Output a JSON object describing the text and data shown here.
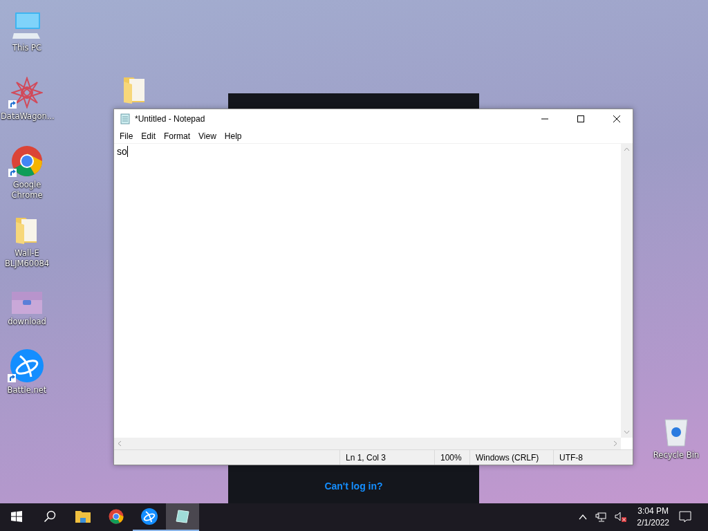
{
  "desktop_icons": [
    {
      "kind": "pc",
      "label": "This PC",
      "shortcut": false
    },
    {
      "kind": "star",
      "label": "DataWagon...",
      "shortcut": true
    },
    {
      "kind": "chrome",
      "label": "Google Chrome",
      "shortcut": true
    },
    {
      "kind": "folder",
      "label": "Wall-E BLJM60084",
      "shortcut": false
    },
    {
      "kind": "thumb",
      "label": "download",
      "shortcut": false
    },
    {
      "kind": "battlenet",
      "label": "Battle.net",
      "shortcut": true
    }
  ],
  "recycle_bin": {
    "label": "Recycle Bin"
  },
  "background_window": {
    "link": "Can't log in?"
  },
  "notepad": {
    "title": "*Untitled - Notepad",
    "menu": [
      "File",
      "Edit",
      "Format",
      "View",
      "Help"
    ],
    "text": "so",
    "status": [
      "Ln 1, Col 3",
      "100%",
      "Windows (CRLF)",
      "UTF-8"
    ]
  },
  "taskbar": {
    "items": [
      {
        "kind": "start",
        "running": false,
        "selected": false
      },
      {
        "kind": "search",
        "running": false,
        "selected": false
      },
      {
        "kind": "explorer",
        "running": false,
        "selected": false
      },
      {
        "kind": "chrome",
        "running": false,
        "selected": false
      },
      {
        "kind": "battlenet",
        "running": true,
        "selected": false
      },
      {
        "kind": "notepad",
        "running": true,
        "selected": true
      }
    ],
    "time": "3:04 PM",
    "date": "2/1/2022"
  }
}
